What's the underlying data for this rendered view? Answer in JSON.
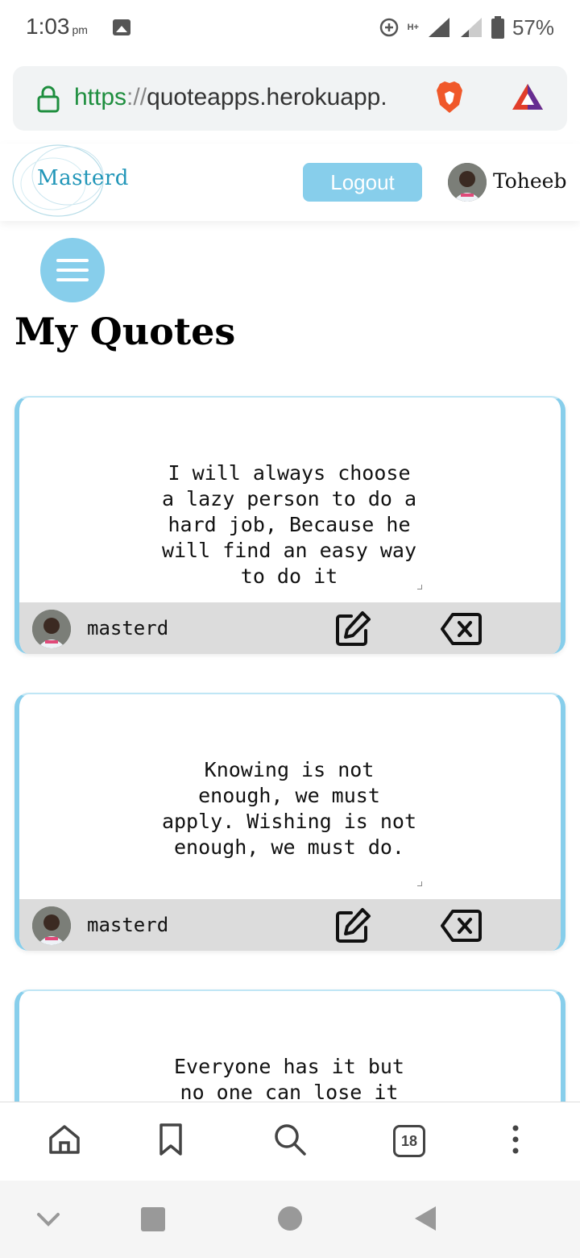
{
  "status_bar": {
    "time": "1:03",
    "ampm": "pm",
    "battery_percent": "57%",
    "network_label": "H+",
    "icons": [
      "gallery-icon",
      "data-saver-icon",
      "signal-icon",
      "battery-icon"
    ]
  },
  "browser": {
    "url_scheme": "https",
    "url_sep": "://",
    "url_host": "quoteapps.herokuapp.",
    "tab_count": "18",
    "toolbar_icons": [
      "home-icon",
      "bookmark-icon",
      "search-icon",
      "tabs-icon",
      "more-icon"
    ]
  },
  "header": {
    "logo": "Masterd",
    "logout_label": "Logout",
    "user_name": "Toheeb"
  },
  "page": {
    "title": "My Quotes"
  },
  "quotes": [
    {
      "text": "I will always choose a lazy person to do a hard job, Because he will find an easy way to do it",
      "author": "masterd"
    },
    {
      "text": "Knowing is not enough, we must apply. Wishing is not enough, we must do.",
      "author": "masterd"
    },
    {
      "text": "Everyone has it but no one can lose it",
      "author": ""
    }
  ],
  "colors": {
    "accent": "#87ceeb",
    "logo": "#2196b8",
    "url_green": "#1e8e3e",
    "footer_gray": "#dcdcdc"
  }
}
